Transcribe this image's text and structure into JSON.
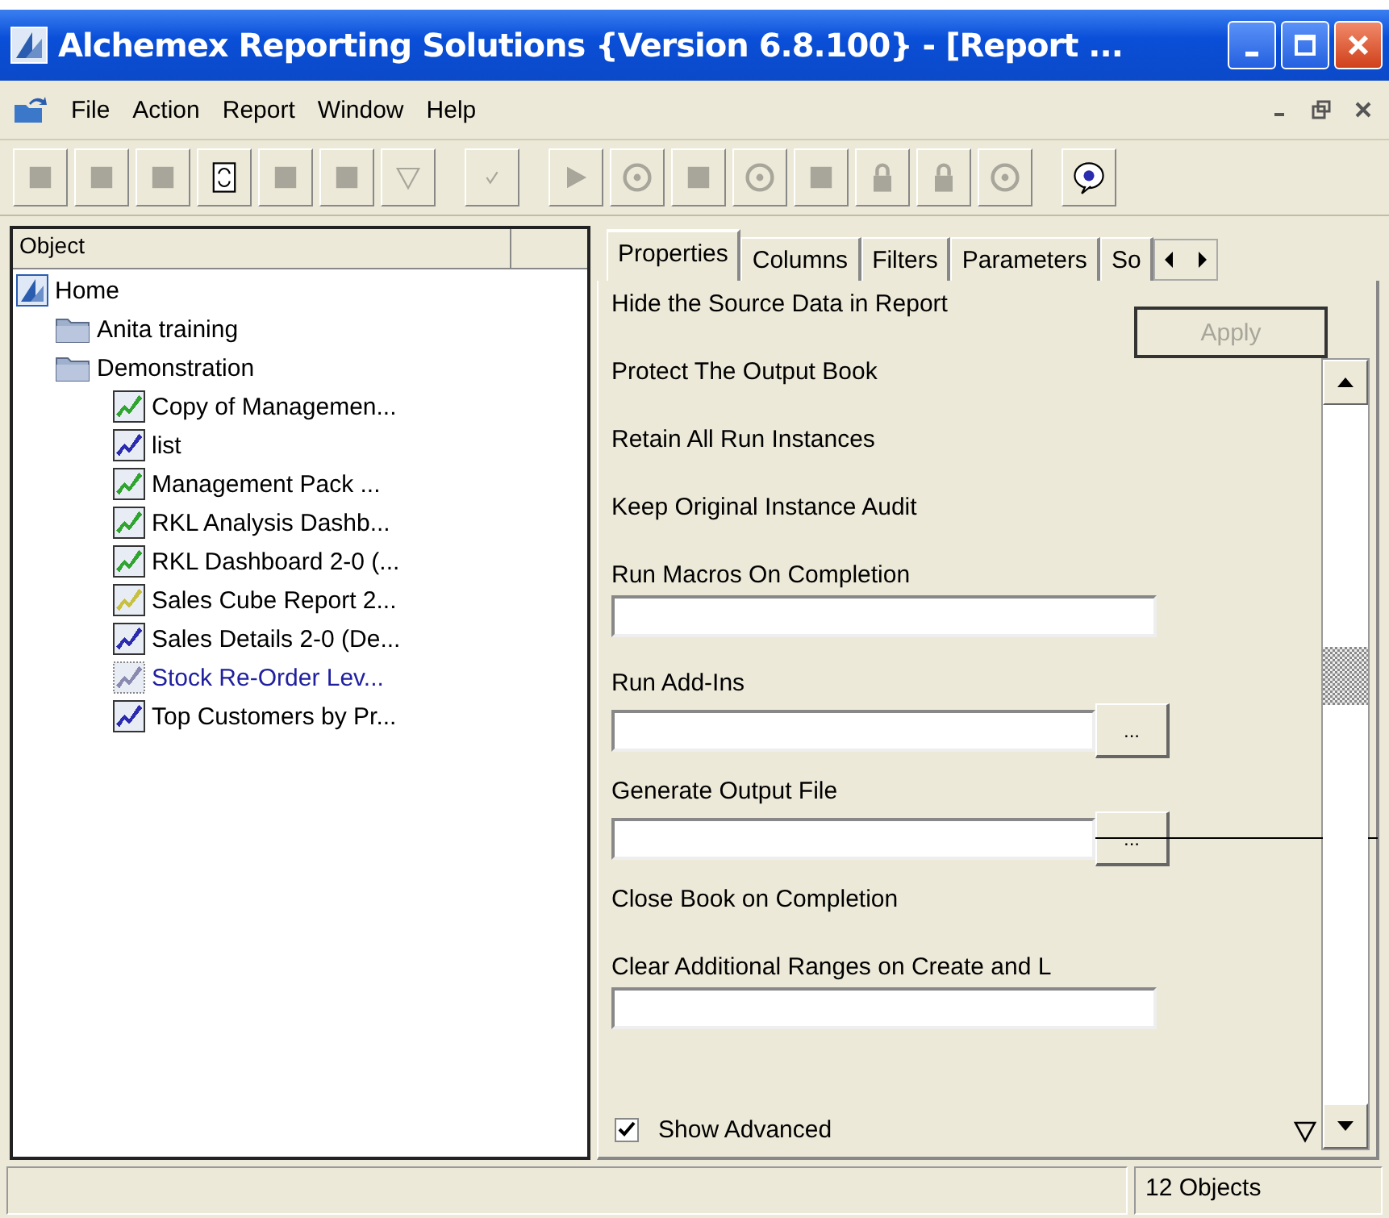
{
  "window": {
    "title": "Alchemex Reporting Solutions {Version 6.8.100} - [Report ..."
  },
  "menu": [
    "File",
    "Action",
    "Report",
    "Window",
    "Help"
  ],
  "toolbar": [
    {
      "disabled": true
    },
    {
      "disabled": true
    },
    {
      "disabled": true
    },
    {
      "disabled": false
    },
    {
      "disabled": true
    },
    {
      "disabled": true
    },
    {
      "disabled": true
    },
    {
      "disabled": true
    },
    {
      "disabled": true
    },
    {
      "disabled": true
    },
    {
      "disabled": true
    },
    {
      "disabled": true
    },
    {
      "disabled": true
    },
    {
      "disabled": true
    },
    {
      "disabled": true
    },
    {
      "disabled": true
    },
    {
      "disabled": false
    }
  ],
  "tree": {
    "column": "Object",
    "items": [
      {
        "kind": "home",
        "label": "Home",
        "children": [
          {
            "kind": "folder",
            "label": "Anita training"
          },
          {
            "kind": "folder",
            "label": "Demonstration",
            "children": [
              {
                "kind": "report",
                "label": "Copy of Managemen...",
                "color": "#2fa52f",
                "selected": false
              },
              {
                "kind": "report",
                "label": "list",
                "color": "#2b2bb0",
                "selected": false
              },
              {
                "kind": "report",
                "label": "Management Pack ...",
                "color": "#2fa52f",
                "selected": false
              },
              {
                "kind": "report",
                "label": "RKL Analysis Dashb...",
                "color": "#2fa52f",
                "selected": false
              },
              {
                "kind": "report",
                "label": "RKL Dashboard 2-0 (...",
                "color": "#2fa52f",
                "selected": false
              },
              {
                "kind": "report",
                "label": "Sales Cube Report 2...",
                "color": "#c8c040",
                "selected": false
              },
              {
                "kind": "report",
                "label": "Sales Details 2-0 (De...",
                "color": "#2b2bb0",
                "selected": false
              },
              {
                "kind": "report",
                "label": "Stock Re-Order Lev...",
                "color": "#8a8ab0",
                "selected": true
              },
              {
                "kind": "report",
                "label": "Top Customers by Pr...",
                "color": "#2b2bb0",
                "selected": false
              }
            ]
          }
        ]
      }
    ]
  },
  "tabs": [
    {
      "label": "Properties",
      "selected": true
    },
    {
      "label": "Columns",
      "selected": false
    },
    {
      "label": "Filters",
      "selected": false
    },
    {
      "label": "Parameters",
      "selected": false
    },
    {
      "label": "So",
      "selected": false
    }
  ],
  "apply_button": {
    "label": "Apply",
    "disabled": true
  },
  "properties": [
    {
      "kind": "label",
      "label": "Hide the Source Data in Report"
    },
    {
      "kind": "label",
      "label": "Protect The Output Book"
    },
    {
      "kind": "label",
      "label": "Retain All Run Instances"
    },
    {
      "kind": "label",
      "label": "Keep Original Instance Audit"
    },
    {
      "kind": "field",
      "label": "Run Macros On Completion"
    },
    {
      "kind": "browse",
      "label": "Run Add-Ins",
      "button": "..."
    },
    {
      "kind": "browse",
      "label": "Generate Output File",
      "button": "..."
    },
    {
      "kind": "label",
      "label": "Close Book on Completion"
    },
    {
      "kind": "field",
      "label": "Clear Additional Ranges on Create and L"
    }
  ],
  "show_advanced": {
    "label": "Show Advanced",
    "checked": true
  },
  "status_bar": {
    "count": "12 Objects"
  }
}
